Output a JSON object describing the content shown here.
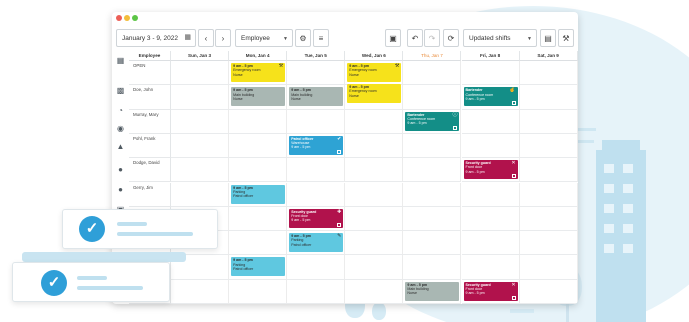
{
  "colors": {
    "yellow": "#f6e21b",
    "gray": "#a9b7b3",
    "teal": "#138e87",
    "blue": "#2ea3d4",
    "crimson": "#b1124c",
    "cyan": "#5fc8e0",
    "accent": "#2f9fd8"
  },
  "toolbar": {
    "date_range": "January 3 - 9, 2022",
    "calendar_icon": "calendar-icon",
    "prev_icon": "chevron-left-icon",
    "next_icon": "chevron-right-icon",
    "group_by": "Employee",
    "settings_icon": "gear-icon",
    "filter_icon": "sliders-icon",
    "camera_icon": "camera-icon",
    "undo_icon": "undo-icon",
    "redo_icon": "redo-icon",
    "refresh_icon": "refresh-icon",
    "shift_filter": "Updated shifts",
    "export_icon": "export-icon",
    "tools_icon": "wrench-icon"
  },
  "sidebar": {
    "icons": [
      "grid-icon",
      "badge-icon",
      "chart-icon",
      "chat-icon",
      "bell-icon",
      "people-icon",
      "group-icon",
      "briefcase-icon"
    ]
  },
  "header": {
    "employee_col": "Employee",
    "days": [
      {
        "label": "Sun, Jan 3",
        "today": false
      },
      {
        "label": "Mon, Jan 4",
        "today": false
      },
      {
        "label": "Tue, Jan 5",
        "today": false
      },
      {
        "label": "Wed, Jan 6",
        "today": false
      },
      {
        "label": "Thu, Jan 7",
        "today": true
      },
      {
        "label": "Fri, Jan 8",
        "today": false
      },
      {
        "label": "Sat, Jan 9",
        "today": false
      }
    ]
  },
  "employees": [
    "OPEN",
    "Doe, John",
    "Murray, Mary",
    "Pohl, Frank",
    "Dodge, David",
    "Gerry, Jim",
    "",
    "",
    "",
    ""
  ],
  "shifts": [
    {
      "row": 0,
      "day": 1,
      "color": "yellow",
      "title": "9 am - 5 pm",
      "line1": "Emergency room",
      "line2": "Nurse",
      "icon": "wrench-icon"
    },
    {
      "row": 0,
      "day": 3,
      "color": "yellow",
      "title": "9 am - 5 pm",
      "line1": "Emergency room",
      "line2": "Nurse",
      "icon": "wrench-icon"
    },
    {
      "row": 0,
      "day": 3,
      "color": "yellow",
      "title": "9 am - 5 pm",
      "line1": "Emergency room",
      "line2": "Nurse",
      "icon": "",
      "stack": 1
    },
    {
      "row": 1,
      "day": 1,
      "color": "gray",
      "title": "9 am - 5 pm",
      "line1": "Main building",
      "line2": "Nurse",
      "icon": ""
    },
    {
      "row": 1,
      "day": 2,
      "color": "gray",
      "title": "9 am - 5 pm",
      "line1": "Main building",
      "line2": "Nurse",
      "icon": ""
    },
    {
      "row": 1,
      "day": 5,
      "color": "teal",
      "title": "Bartender",
      "line1": "Conference room",
      "line2": "9 am - 5 pm",
      "icon": "thumbs-up-icon"
    },
    {
      "row": 2,
      "day": 4,
      "color": "teal",
      "title": "Bartender",
      "line1": "Conference room",
      "line2": "9 am - 5 pm",
      "icon": "info-icon"
    },
    {
      "row": 3,
      "day": 2,
      "color": "blue",
      "title": "Patrol officer",
      "line1": "Warehouse",
      "line2": "9 am - 5 pm",
      "icon": "check-circle-icon"
    },
    {
      "row": 4,
      "day": 5,
      "color": "crimson",
      "title": "Security guard",
      "line1": "Front door",
      "line2": "9 am - 5 pm",
      "icon": "close-icon"
    },
    {
      "row": 5,
      "day": 1,
      "color": "cyan",
      "title": "9 am - 5 pm",
      "line1": "Parking",
      "line2": "Patrol officer",
      "icon": ""
    },
    {
      "row": 6,
      "day": 2,
      "color": "crimson",
      "title": "Security guard",
      "line1": "Front door",
      "line2": "9 am - 5 pm",
      "icon": "add-user-icon"
    },
    {
      "row": 7,
      "day": 2,
      "color": "cyan",
      "title": "9 am - 5 pm",
      "line1": "Parking",
      "line2": "Patrol officer",
      "icon": "edit-icon"
    },
    {
      "row": 8,
      "day": 1,
      "color": "cyan",
      "title": "9 am - 5 pm",
      "line1": "Parking",
      "line2": "Patrol officer",
      "icon": ""
    },
    {
      "row": 9,
      "day": 4,
      "color": "gray",
      "title": "9 am - 5 pm",
      "line1": "Main building",
      "line2": "Nurse",
      "icon": ""
    },
    {
      "row": 9,
      "day": 5,
      "color": "crimson",
      "title": "Security guard",
      "line1": "Front door",
      "line2": "9 am - 5 pm",
      "icon": "close-icon"
    }
  ],
  "cards": {
    "icon": "check-circle-icon"
  }
}
